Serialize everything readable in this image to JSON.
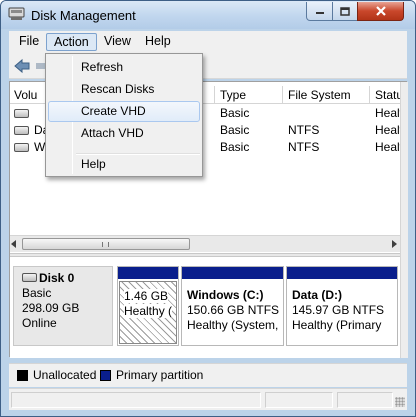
{
  "window": {
    "title": "Disk Management",
    "controls": {
      "minimize": "minimize-icon",
      "maximize": "maximize-icon",
      "close": "close-icon"
    }
  },
  "menubar": {
    "file": "File",
    "action": "Action",
    "view": "View",
    "help": "Help"
  },
  "action_menu": {
    "items": [
      "Refresh",
      "Rescan Disks",
      "Create VHD",
      "Attach VHD",
      "Help"
    ],
    "highlighted": "Create VHD"
  },
  "volume_list": {
    "columns": {
      "volume": "Volu",
      "type": "Type",
      "file_system": "File System",
      "status": "Status"
    },
    "rows": [
      {
        "name": "",
        "type": "Basic",
        "file_system": "",
        "status": "Healtl"
      },
      {
        "name": "Da",
        "type": "Basic",
        "file_system": "NTFS",
        "status": "Healtl"
      },
      {
        "name": "Wi",
        "type": "Basic",
        "file_system": "NTFS",
        "status": "Healtl"
      }
    ]
  },
  "disk": {
    "name": "Disk 0",
    "type": "Basic",
    "size": "298.09 GB",
    "state": "Online",
    "partitions": [
      {
        "name": "",
        "size": "1.46 GB",
        "status": "Healthy ("
      },
      {
        "name": "Windows  (C:)",
        "size": "150.66 GB NTFS",
        "status": "Healthy (System,"
      },
      {
        "name": "Data  (D:)",
        "size": "145.97 GB NTFS",
        "status": "Healthy (Primary"
      }
    ]
  },
  "legend": {
    "unallocated": "Unallocated",
    "primary": "Primary partition",
    "colors": {
      "unallocated": "#000000",
      "primary": "#0a1e8c"
    }
  }
}
